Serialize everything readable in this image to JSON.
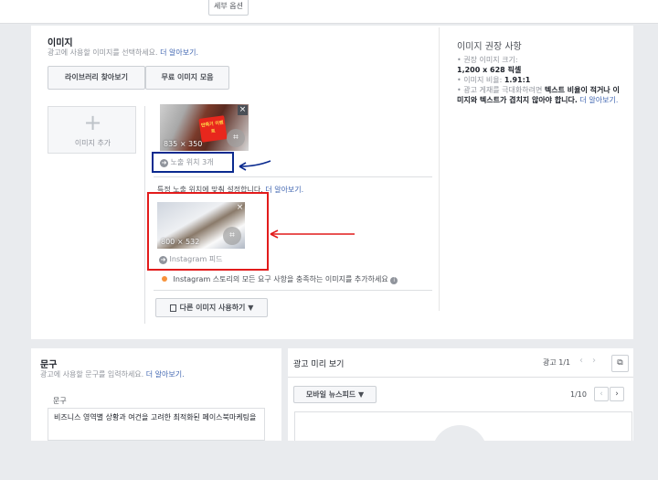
{
  "topbar": {
    "detail_options": "세부 옵션"
  },
  "image_section": {
    "title": "이미지",
    "subtitle": "광고에 사용할 이미지를 선택하세요.",
    "learn_more": "더 알아보기.",
    "library_button": "라이브러리 찾아보기",
    "free_images_button": "무료 이미지 모음",
    "add_image": "이미지 추가",
    "thumbnail1": {
      "dims": "835 × 350",
      "badge_text": "반죽기 이벤트",
      "placements": "노출 위치 3개"
    },
    "specific_note": "특정 노출 위치에 맞춰 설정합니다.",
    "specific_learn_more": "더 알아보기.",
    "thumbnail2": {
      "dims": "800 × 532",
      "placement": "Instagram 피드"
    },
    "stories_warning": "Instagram 스토리의 모든 요구 사항을 충족하는 이미지를 추가하세요",
    "other_image_button": "다른 이미지 사용하기"
  },
  "recommendations": {
    "title": "이미지 권장 사항",
    "items": [
      {
        "prefix": "권장 이미지 크기:",
        "value": "1,200 x 628 픽셀"
      },
      {
        "prefix": "이미지 비율:",
        "value": "1.91:1"
      }
    ],
    "note_plain": "광고 게재를 극대화하려면",
    "note_bold": "텍스트 비율이 적거나 이미지와 텍스트가 겹치지 않아야 합니다.",
    "note_link": "더 알아보기."
  },
  "text_section": {
    "title": "문구",
    "subtitle": "광고에 사용할 문구를 입력하세요.",
    "learn_more": "더 알아보기.",
    "field_label": "문구",
    "field_value": "비즈니스 영역별 상황과 여건을 고려한 최적화된 페이스북마케팅을"
  },
  "preview": {
    "title": "광고 미리 보기",
    "ad_count": "광고 1/1",
    "dropdown": "모바일 뉴스피드",
    "page_count": "1/10"
  },
  "colors": {
    "link": "#4267b2",
    "annotation_red": "#e21b1b",
    "annotation_blue": "#0a2a8f",
    "warning": "#f7923b"
  }
}
